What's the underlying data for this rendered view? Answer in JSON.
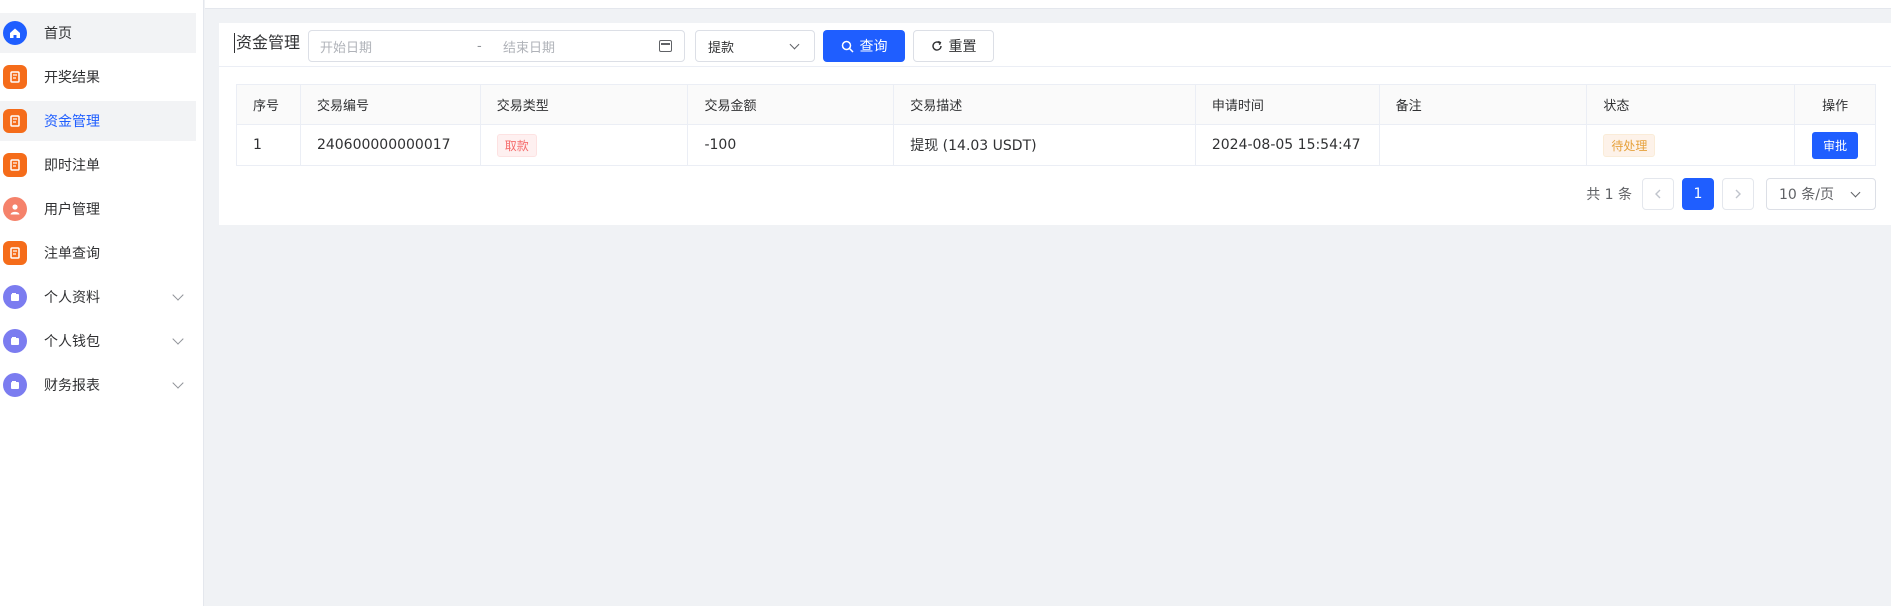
{
  "sidebar": {
    "items": [
      {
        "label": "首页",
        "icon": "home-icon",
        "color": "#1f5eff"
      },
      {
        "label": "开奖结果",
        "icon": "document-icon",
        "color": "#f56c1a"
      },
      {
        "label": "资金管理",
        "icon": "document-icon",
        "color": "#f56c1a"
      },
      {
        "label": "即时注单",
        "icon": "document-icon",
        "color": "#f56c1a"
      },
      {
        "label": "用户管理",
        "icon": "user-icon",
        "color": "#f5826b"
      },
      {
        "label": "注单查询",
        "icon": "document-icon",
        "color": "#f56c1a"
      },
      {
        "label": "个人资料",
        "icon": "folder-icon",
        "color": "#7b7cf0"
      },
      {
        "label": "个人钱包",
        "icon": "folder-icon",
        "color": "#7b7cf0"
      },
      {
        "label": "财务报表",
        "icon": "folder-icon",
        "color": "#7b7cf0"
      }
    ]
  },
  "filter": {
    "title": "资金管理",
    "start_placeholder": "开始日期",
    "separator": "-",
    "end_placeholder": "结束日期",
    "type_select": "提款",
    "search_label": "查询",
    "reset_label": "重置"
  },
  "table": {
    "headers": [
      "序号",
      "交易编号",
      "交易类型",
      "交易金额",
      "交易描述",
      "申请时间",
      "备注",
      "状态",
      "操作"
    ],
    "rows": [
      {
        "index": "1",
        "txn_no": "240600000000017",
        "type": "取款",
        "amount": "-100",
        "desc": "提现 (14.03 USDT)",
        "time": "2024-08-05 15:54:47",
        "remark": "",
        "status": "待处理",
        "action": "审批"
      }
    ]
  },
  "pagination": {
    "total": "共 1 条",
    "current": "1",
    "page_size": "10 条/页"
  },
  "colors": {
    "primary": "#1f5eff",
    "warning_tag": "#e6a23c",
    "danger_tag": "#f56c6c"
  }
}
